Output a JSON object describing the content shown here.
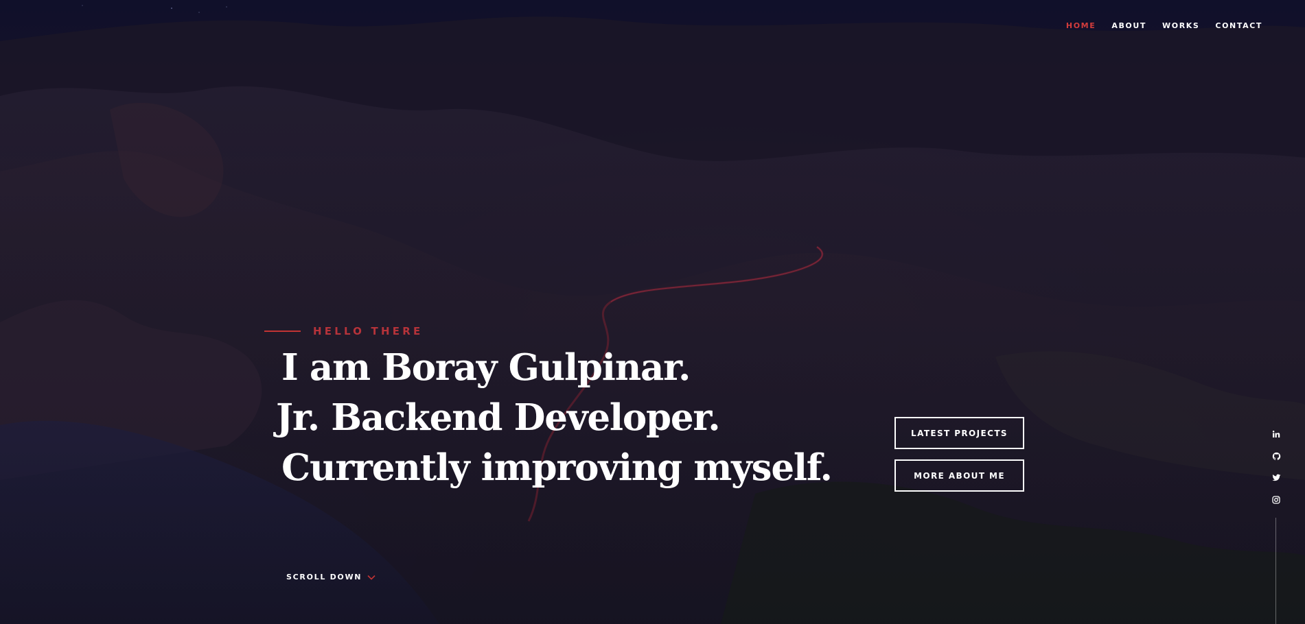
{
  "nav": {
    "items": [
      {
        "label": "HOME",
        "active": true
      },
      {
        "label": "ABOUT",
        "active": false
      },
      {
        "label": "WORKS",
        "active": false
      },
      {
        "label": "CONTACT",
        "active": false
      }
    ],
    "active_color": "#d23c3c"
  },
  "hero": {
    "intro": "HELLO THERE",
    "headline": [
      "I am Boray Gulpinar.",
      "Jr. Backend Developer.",
      "Currently improving myself."
    ],
    "accent_color": "#b6333a"
  },
  "buttons": {
    "latest_projects": "LATEST PROJECTS",
    "more_about_me": "MORE ABOUT ME"
  },
  "social": {
    "icons": [
      "linkedin-icon",
      "github-icon",
      "twitter-icon",
      "instagram-icon"
    ]
  },
  "scroll": {
    "label": "SCROLL DOWN",
    "icon": "chevron-down-icon"
  }
}
